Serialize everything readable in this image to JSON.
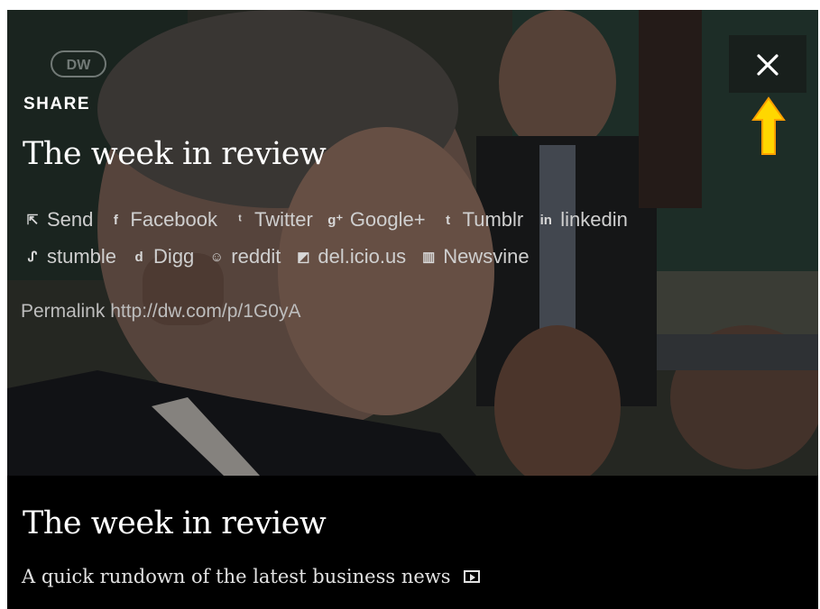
{
  "share": {
    "heading": "SHARE",
    "title": "The week in review",
    "links_row1": [
      {
        "icon": "external-link-icon",
        "glyph": "⇱",
        "label": "Send"
      },
      {
        "icon": "facebook-icon",
        "glyph": "f",
        "label": "Facebook"
      },
      {
        "icon": "twitter-icon",
        "glyph": "ᵗ",
        "label": "Twitter"
      },
      {
        "icon": "google-plus-icon",
        "glyph": "g⁺",
        "label": "Google+"
      },
      {
        "icon": "tumblr-icon",
        "glyph": "t",
        "label": "Tumblr"
      },
      {
        "icon": "linkedin-icon",
        "glyph": "in",
        "label": "linkedin"
      }
    ],
    "links_row2": [
      {
        "icon": "stumbleupon-icon",
        "glyph": "ᔑ",
        "label": "stumble"
      },
      {
        "icon": "digg-icon",
        "glyph": "d",
        "label": "Digg"
      },
      {
        "icon": "reddit-icon",
        "glyph": "☺",
        "label": "reddit"
      },
      {
        "icon": "delicious-icon",
        "glyph": "◩",
        "label": "del.icio.us"
      },
      {
        "icon": "newsvine-icon",
        "glyph": "▥",
        "label": "Newsvine"
      }
    ],
    "permalink": "Permalink http://dw.com/p/1G0yA"
  },
  "caption": {
    "title": "The week in review",
    "subtitle": "A quick rundown of the latest business news"
  },
  "logo_text": "DW",
  "colors": {
    "arrow": "#ffd700",
    "caption_bg": "#000000"
  }
}
